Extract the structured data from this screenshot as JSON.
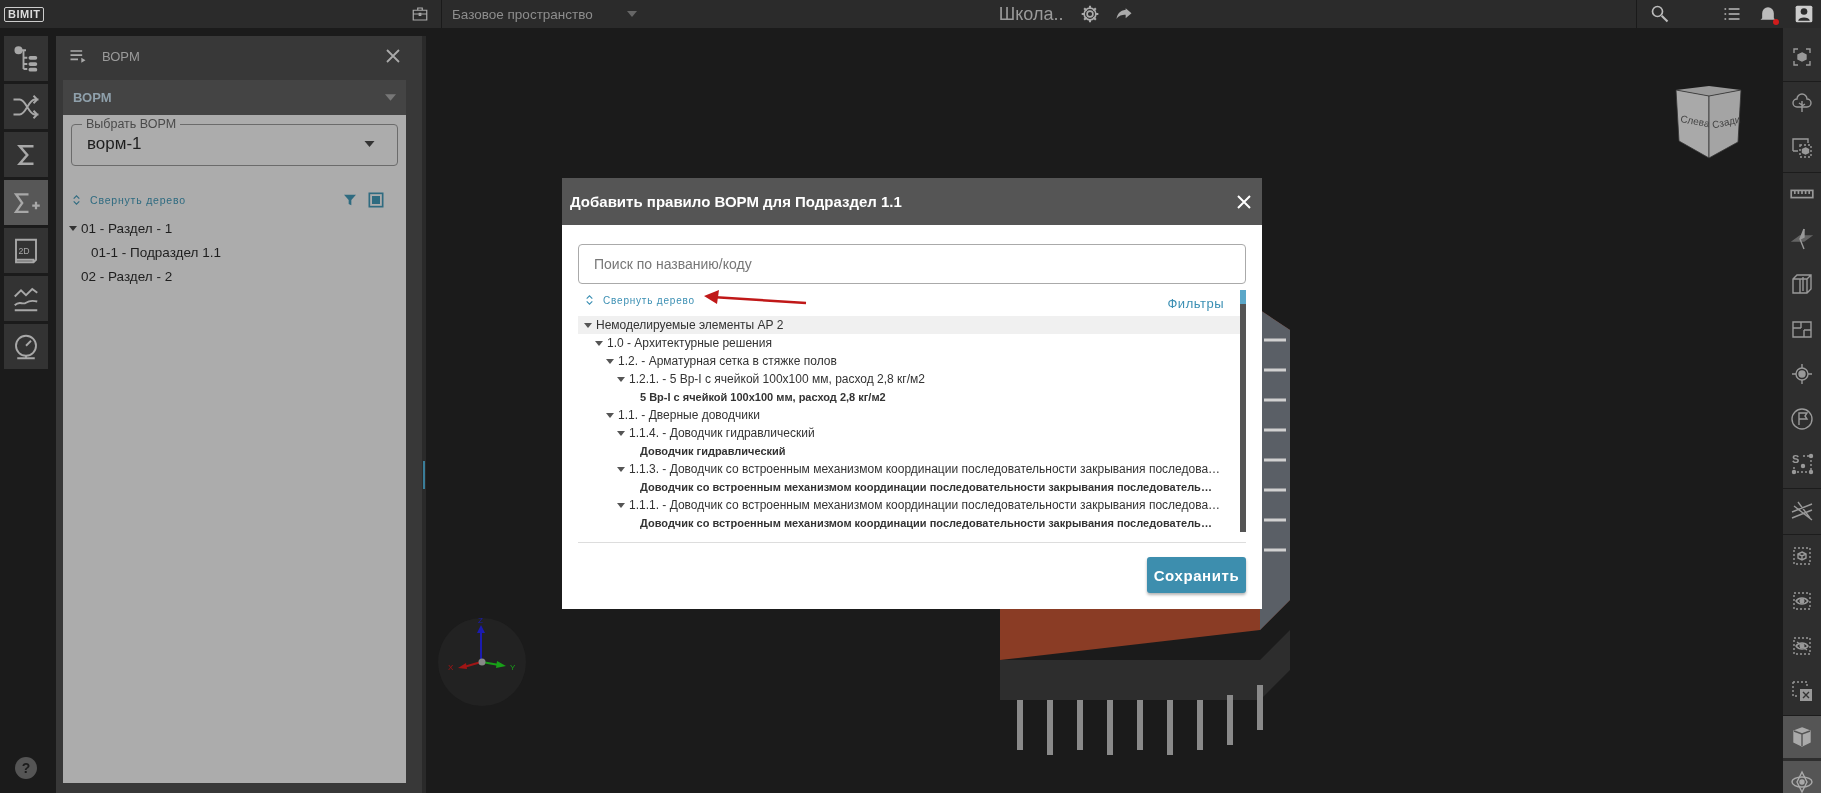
{
  "top_bar": {
    "logo": "BIMIT",
    "workspace": "Базовое пространство",
    "project_title": "Школа..",
    "notifications": true
  },
  "left_toolbar": [
    {
      "kind": "tree",
      "selected": false
    },
    {
      "kind": "shuffle",
      "selected": false
    },
    {
      "kind": "sum",
      "selected": false
    },
    {
      "kind": "sum-add",
      "selected": true
    },
    {
      "kind": "sheet-2d",
      "label": "2D",
      "selected": false
    },
    {
      "kind": "chart",
      "selected": false
    },
    {
      "kind": "gauge",
      "selected": false
    }
  ],
  "help": "?",
  "side_panel": {
    "title": "ВОРМ",
    "section": {
      "title": "ВОРМ",
      "expanded": true
    },
    "select": {
      "label": "Выбрать ВОРМ",
      "value": "ворм-1"
    },
    "collapse_link": "Свернуть дерево",
    "tree": [
      {
        "label": "01 - Раздел - 1",
        "expanded": true,
        "children": [
          {
            "label": "01-1 - Подраздел 1.1"
          }
        ]
      },
      {
        "label": "02 - Раздел - 2"
      }
    ]
  },
  "dialog": {
    "title": "Добавить правило ВОРМ для Подраздел 1.1",
    "search": {
      "placeholder": "Поиск по названию/коду"
    },
    "collapse_link": "Свернуть дерево",
    "filters_link": "Фильтры",
    "tree": [
      {
        "label": "Немоделируемые элементы АР 2",
        "kind": "group",
        "expanded": true,
        "selected": true,
        "children": [
          {
            "label": "1.0 - Архитектурные решения",
            "kind": "group",
            "expanded": true,
            "selected": false,
            "children": [
              {
                "label": "1.2. - Арматурная сетка в стяжке полов",
                "kind": "group",
                "expanded": true,
                "selected": false,
                "children": [
                  {
                    "label": "1.2.1. - 5 Вр-I с ячейкой 100х100 мм, расход 2,8 кг/м2",
                    "kind": "group",
                    "expanded": true,
                    "selected": false,
                    "children": [
                      {
                        "label": "5 Вр-I с ячейкой 100х100 мм, расход 2,8 кг/м2",
                        "kind": "item",
                        "selected": false
                      }
                    ]
                  }
                ]
              },
              {
                "label": "1.1. - Дверные доводчики",
                "kind": "group",
                "expanded": true,
                "selected": false,
                "children": [
                  {
                    "label": "1.1.4. - Доводчик гидравлический",
                    "kind": "group",
                    "expanded": true,
                    "selected": false,
                    "children": [
                      {
                        "label": "Доводчик гидравлический",
                        "kind": "item",
                        "selected": false
                      }
                    ]
                  },
                  {
                    "label": "1.1.3. - Доводчик со встроенным механизмом координации последовательности закрывания последова…",
                    "kind": "group",
                    "expanded": true,
                    "selected": false,
                    "children": [
                      {
                        "label": "Доводчик со встроенным механизмом координации последовательности закрывания последователь…",
                        "kind": "item",
                        "selected": false
                      }
                    ]
                  },
                  {
                    "label": "1.1.1. - Доводчик со встроенным механизмом координации последовательности закрывания последова…",
                    "kind": "group",
                    "expanded": true,
                    "selected": false,
                    "children": [
                      {
                        "label": "Доводчик со встроенным механизмом координации последовательности закрывания последователь…",
                        "kind": "item",
                        "selected": false
                      }
                    ]
                  }
                ]
              }
            ]
          }
        ]
      }
    ],
    "save_button": "Сохранить"
  },
  "view_cube": {
    "left_face": "Слева",
    "right_face": "Сзади"
  },
  "axis_gizmo": {
    "z": "Z",
    "x": "X",
    "y": "Y"
  },
  "right_toolbar": [
    [
      {
        "kind": "focus",
        "selected": false
      }
    ],
    [
      {
        "kind": "cloud",
        "selected": false
      },
      {
        "kind": "screen-select",
        "selected": false
      }
    ],
    [
      {
        "kind": "ruler",
        "selected": false
      },
      {
        "kind": "section-plane",
        "selected": false
      },
      {
        "kind": "section-box",
        "selected": false
      },
      {
        "kind": "floorplan",
        "selected": false
      },
      {
        "kind": "target",
        "selected": false
      },
      {
        "kind": "flag",
        "selected": false
      },
      {
        "kind": "s-points",
        "label": "S",
        "selected": false
      }
    ],
    [
      {
        "kind": "grid-axes",
        "selected": false
      }
    ],
    [
      {
        "kind": "box-dashed",
        "selected": false
      },
      {
        "kind": "eye-dashed",
        "selected": false
      },
      {
        "kind": "eye-off-dashed",
        "selected": false
      },
      {
        "kind": "x-dashed",
        "selected": false
      }
    ],
    [
      {
        "kind": "cube",
        "selected": true
      },
      {
        "kind": "orbit",
        "selected": true
      }
    ]
  ]
}
